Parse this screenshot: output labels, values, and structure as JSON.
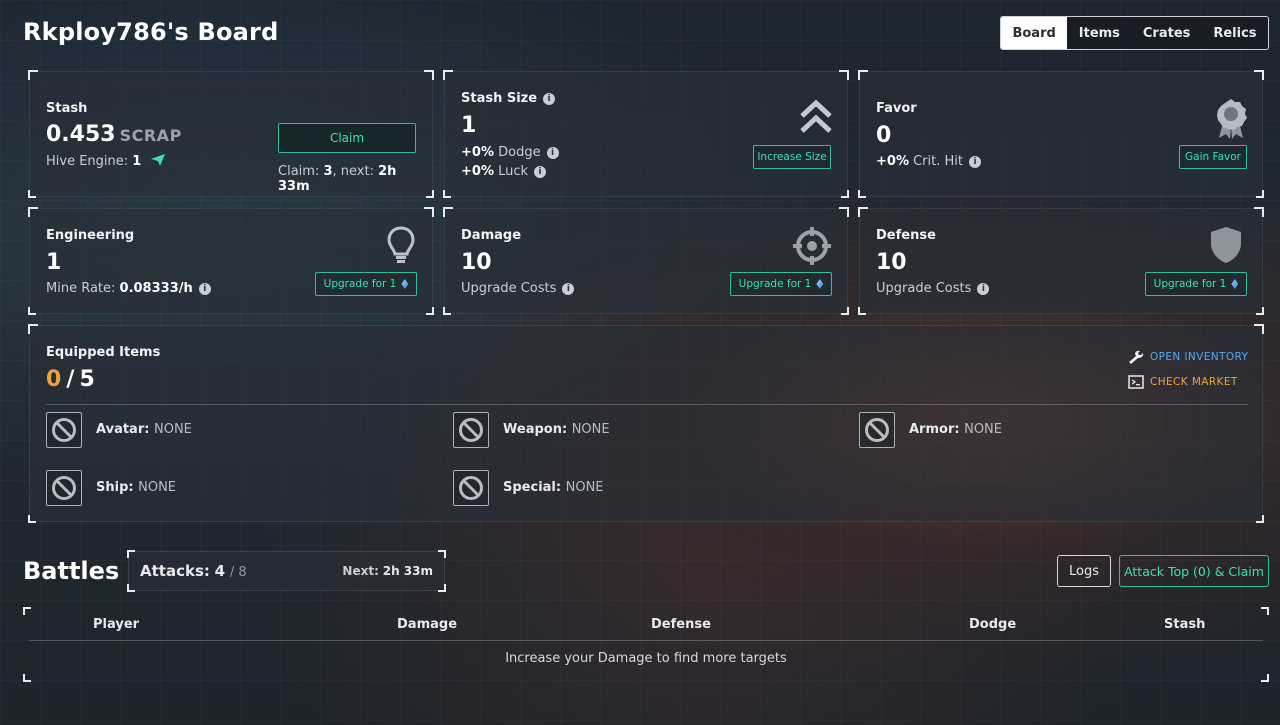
{
  "header": {
    "title": "Rkploy786's Board",
    "tabs": [
      {
        "label": "Board",
        "active": true
      },
      {
        "label": "Items",
        "active": false
      },
      {
        "label": "Crates",
        "active": false
      },
      {
        "label": "Relics",
        "active": false
      }
    ]
  },
  "stash": {
    "label": "Stash",
    "value": "0.453",
    "unit": "SCRAP",
    "hive_label": "Hive Engine:",
    "hive_value": "1",
    "claim_label": "Claim",
    "claim_text": "Claim:",
    "claim_count": "3",
    "next_text": ", next:",
    "next_value": "2h 33m"
  },
  "stash_size": {
    "label": "Stash Size",
    "value": "1",
    "dodge_value": "+0%",
    "dodge_label": "Dodge",
    "luck_value": "+0%",
    "luck_label": "Luck",
    "button": "Increase Size"
  },
  "favor": {
    "label": "Favor",
    "value": "0",
    "crit_value": "+0%",
    "crit_label": "Crit. Hit",
    "button": "Gain Favor"
  },
  "engineering": {
    "label": "Engineering",
    "value": "1",
    "mine_label": "Mine Rate:",
    "mine_value": "0.08333/h",
    "button": "Upgrade for 1"
  },
  "damage": {
    "label": "Damage",
    "value": "10",
    "costs_label": "Upgrade Costs",
    "button": "Upgrade for 1"
  },
  "defense": {
    "label": "Defense",
    "value": "10",
    "costs_label": "Upgrade Costs",
    "button": "Upgrade for 1"
  },
  "equipped": {
    "label": "Equipped Items",
    "count": "0",
    "separator": "/",
    "max": "5",
    "open_inventory": "OPEN INVENTORY",
    "check_market": "CHECK MARKET",
    "slots": [
      {
        "name": "Avatar:",
        "value": "NONE"
      },
      {
        "name": "Weapon:",
        "value": "NONE"
      },
      {
        "name": "Armor:",
        "value": "NONE"
      },
      {
        "name": "Ship:",
        "value": "NONE"
      },
      {
        "name": "Special:",
        "value": "NONE"
      }
    ]
  },
  "battles": {
    "title": "Battles",
    "attacks_label": "Attacks:",
    "attacks_value": "4",
    "attacks_max": "/ 8",
    "next_label": "Next:",
    "next_value": "2h 33m",
    "logs_button": "Logs",
    "attack_button": "Attack Top (0) & Claim",
    "columns": [
      "Player",
      "Damage",
      "Defense",
      "Dodge",
      "Stash"
    ],
    "empty_message": "Increase your Damage to find more targets"
  },
  "colors": {
    "accent_green": "#3ee0b3",
    "accent_orange": "#f0a23a",
    "accent_blue": "#5aa8f0"
  }
}
